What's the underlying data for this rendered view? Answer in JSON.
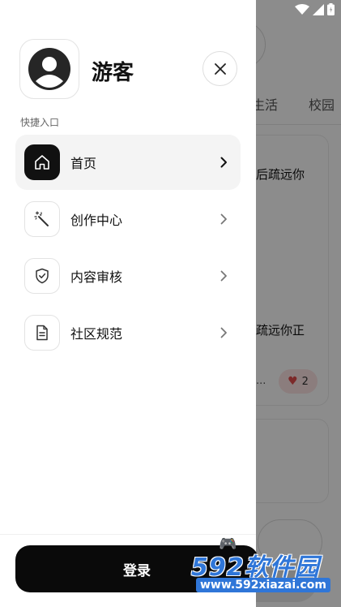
{
  "background": {
    "tabs": [
      "生活",
      "校园"
    ],
    "card1": {
      "title_fragment": "后疏远你",
      "body_fragment": "疏远你正",
      "dots": "...",
      "like_count": "2"
    }
  },
  "drawer": {
    "username": "游客",
    "section_title": "快捷入口",
    "menu": [
      {
        "label": "首页",
        "icon": "home-icon",
        "active": true
      },
      {
        "label": "创作中心",
        "icon": "magic-wand-icon",
        "active": false
      },
      {
        "label": "内容审核",
        "icon": "shield-check-icon",
        "active": false
      },
      {
        "label": "社区规范",
        "icon": "document-icon",
        "active": false
      }
    ],
    "login_label": "登录"
  },
  "watermark": {
    "logo": "592软件园",
    "url": "www.592xiazai.com"
  },
  "colors": {
    "accent": "#0a0a0a",
    "active_item_bg": "#f4f4f4",
    "watermark_blue": "#2f76d8"
  }
}
